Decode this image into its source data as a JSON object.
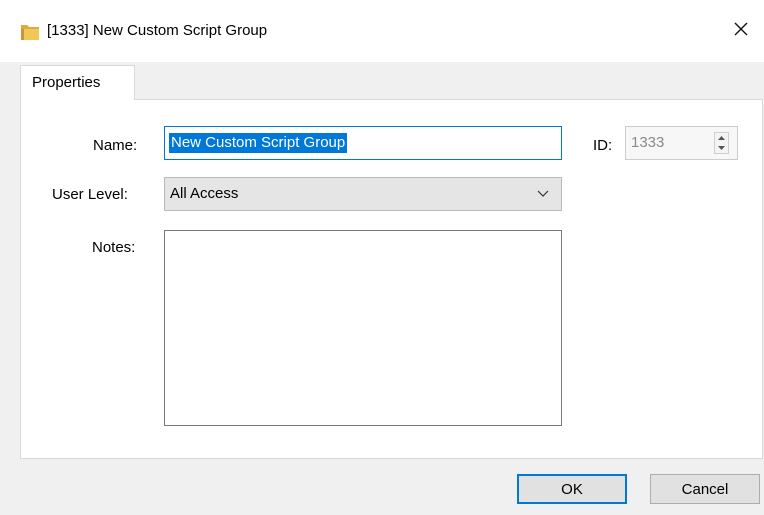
{
  "window": {
    "title": "[1333] New Custom Script Group",
    "icon": "folder-icon",
    "close_icon": "close-icon"
  },
  "tabs": [
    {
      "label": "Properties",
      "active": true
    }
  ],
  "form": {
    "name_label": "Name:",
    "name_value": "New Custom Script Group",
    "id_label": "ID:",
    "id_value": "1333",
    "user_level_label": "User Level:",
    "user_level_value": "All Access",
    "notes_label": "Notes:",
    "notes_value": ""
  },
  "buttons": {
    "ok": "OK",
    "cancel": "Cancel"
  },
  "colors": {
    "accent": "#0078d7",
    "folder": "#e8b94a"
  }
}
